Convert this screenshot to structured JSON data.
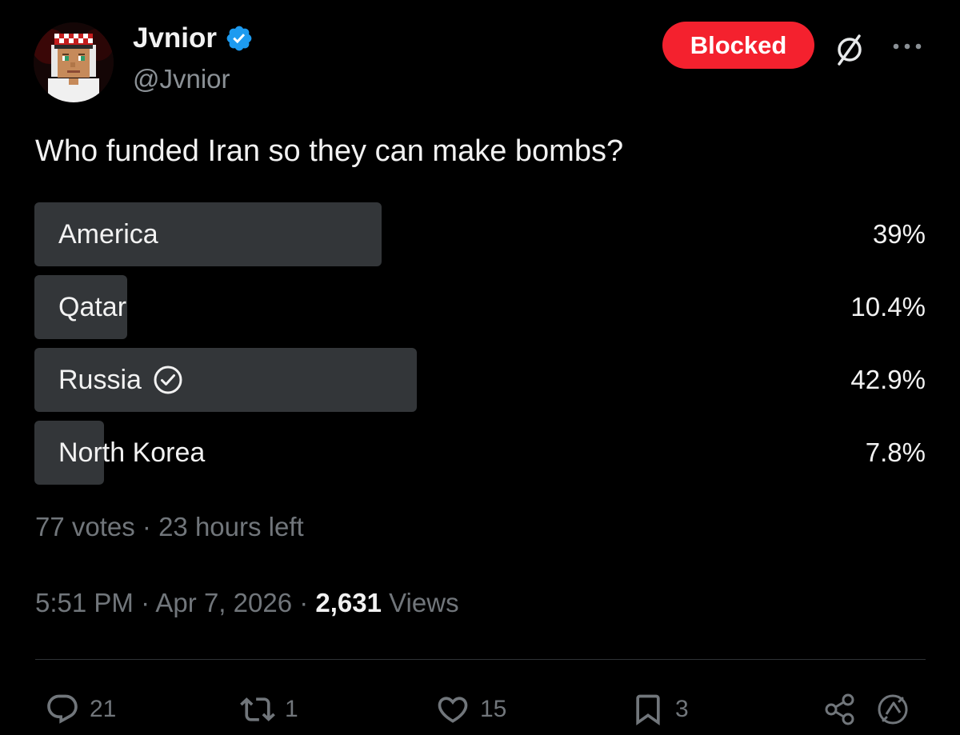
{
  "author": {
    "display_name": "Jvnior",
    "handle": "@Jvnior",
    "verified": true
  },
  "header": {
    "blocked_label": "Blocked",
    "grok_icon": "grok-slash-icon",
    "more_icon": "more-horizontal-icon"
  },
  "tweet": {
    "text": "Who funded Iran so they can make bombs?"
  },
  "poll": {
    "options": [
      {
        "label": "America",
        "percent_text": "39%",
        "percent": 39,
        "selected": false
      },
      {
        "label": "Qatar",
        "percent_text": "10.4%",
        "percent": 10.4,
        "selected": false
      },
      {
        "label": "Russia",
        "percent_text": "42.9%",
        "percent": 42.9,
        "selected": true
      },
      {
        "label": "North Korea",
        "percent_text": "7.8%",
        "percent": 7.8,
        "selected": false
      }
    ],
    "votes": "77 votes",
    "separator": " · ",
    "time_left": "23 hours left"
  },
  "meta": {
    "time": "5:51 PM",
    "date": "Apr 7, 2026",
    "views_count": "2,631",
    "views_label": "Views"
  },
  "actions": {
    "replies": "21",
    "reposts": "1",
    "likes": "15",
    "bookmarks": "3"
  },
  "colors": {
    "blocked": "#f4212e",
    "verified": "#1d9bf0",
    "bar": "#333639",
    "muted": "#71767b"
  }
}
